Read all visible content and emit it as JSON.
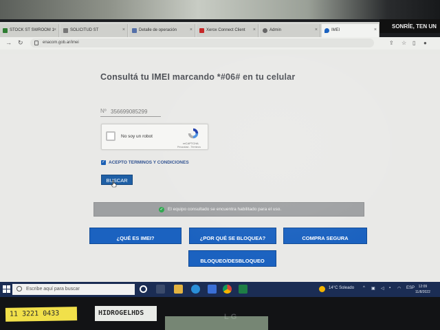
{
  "environment": {
    "banner_text": "SONRÍE, TEN UN",
    "monitor_brand": "LG",
    "sticker_phone": "11 3221 0433",
    "sticker_name": "HIDROGELHDS"
  },
  "browser": {
    "tabs": [
      {
        "label": "STOCK ST SWROOM 1"
      },
      {
        "label": "SOLICITUD ST"
      },
      {
        "label": "Detalle de operación"
      },
      {
        "label": "Xerox Connect Client"
      },
      {
        "label": "Admin"
      },
      {
        "label": "IMEI",
        "active": true
      }
    ],
    "new_tab_label": "+",
    "url": "enacom.gob.ar/imei"
  },
  "page": {
    "title": "Consultá tu IMEI marcando *#06# en tu celular",
    "imei_field": {
      "label": "Nº",
      "value": "356699085299"
    },
    "captcha": {
      "label": "No soy un robot",
      "brand": "reCAPTCHA",
      "links": "Privacidad - Términos"
    },
    "terms": {
      "checked": true,
      "label": "ACEPTO TERMINOS Y CONDICIONES"
    },
    "search_button": "BUSCAR",
    "alert": {
      "text": "El equipo consultado se encuentra habilitado para el uso.",
      "status": "success",
      "color": "#2fa84f"
    },
    "links": {
      "what_is_imei": "¿QUÉ ES IMEI?",
      "why_blocked": "¿POR QUÉ SE BLOQUEA?",
      "safe_purchase": "COMPRA SEGURA",
      "block_unblock": "BLOQUEO/DESBLOQUEO"
    },
    "accent_color": "#1b62c0"
  },
  "taskbar": {
    "search_placeholder": "Escribe aquí para buscar",
    "weather": "14°C  Soleado",
    "language": "ESP",
    "time": "12:09",
    "date": "11/8/2022"
  }
}
